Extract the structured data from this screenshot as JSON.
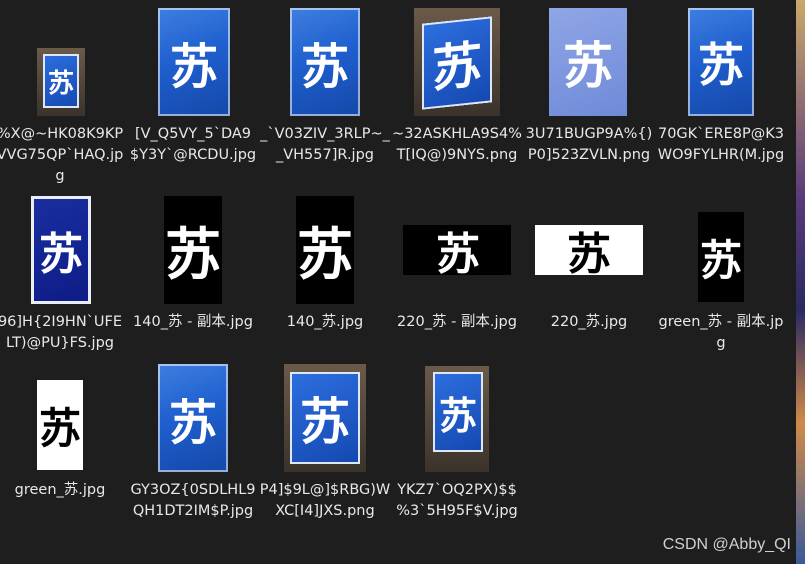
{
  "files": [
    {
      "name": "%X@~HK08K9KPVVG75QP`HAQ.jpg",
      "char": "苏"
    },
    {
      "name": "[V_Q5VY_5`DA9$Y3Y`@RCDU.jpg",
      "char": "苏"
    },
    {
      "name": "_`V03ZIV_3RLP~__VH557]R.jpg",
      "char": "苏"
    },
    {
      "name": "~32ASKHLA9S4%T[IQ@)9NYS.png",
      "char": "苏"
    },
    {
      "name": "3U71BUGP9A%{)P0]523ZVLN.png",
      "char": "苏"
    },
    {
      "name": "70GK`ERE8P@K3WO9FYLHR(M.jpg",
      "char": "苏"
    },
    {
      "name": "96]H{2I9HN`UFELT)@PU}FS.jpg",
      "char": "苏"
    },
    {
      "name": "140_苏 - 副本.jpg",
      "char": "苏"
    },
    {
      "name": "140_苏.jpg",
      "char": "苏"
    },
    {
      "name": "220_苏 - 副本.jpg",
      "char": "苏"
    },
    {
      "name": "220_苏.jpg",
      "char": "苏"
    },
    {
      "name": "green_苏 - 副本.jpg",
      "char": "苏"
    },
    {
      "name": "green_苏.jpg",
      "char": "苏"
    },
    {
      "name": "GY3OZ{0SDLHL9QH1DT2IM$P.jpg",
      "char": "苏"
    },
    {
      "name": "P4]$9L@]$RBG)WXC[I4]JXS.png",
      "char": "苏"
    },
    {
      "name": "YKZ7`OQ2PX)$$%3`5H95F$V.jpg",
      "char": "苏"
    }
  ],
  "watermark": "CSDN @Abby_QI",
  "colors": {
    "background": "#1e1e1e",
    "sign_blue": "#1f5fcf",
    "text": "#e6e6e6"
  }
}
